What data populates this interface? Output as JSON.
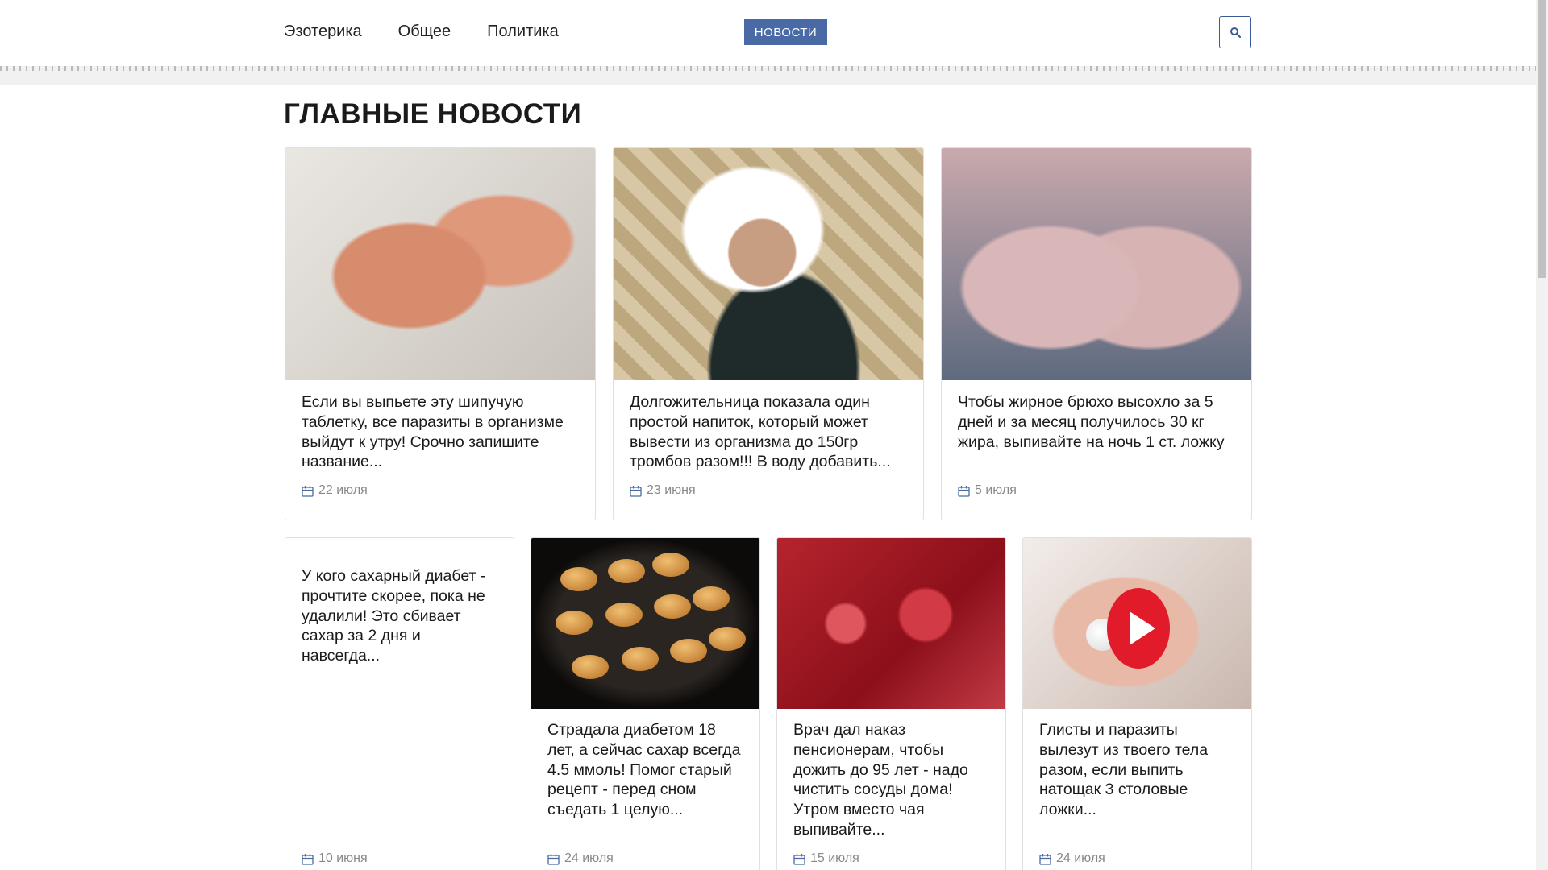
{
  "nav": {
    "items": [
      "Эзотерика",
      "Общее",
      "Политика"
    ],
    "news_button": "НОВОСТИ",
    "search_icon": "search-icon"
  },
  "section_title": "ГЛАВНЫЕ НОВОСТИ",
  "cards": [
    {
      "title": "Если вы выпьете эту шипучую таблетку, все паразиты в организме выйдут к утру! Срочно запишите название...",
      "date": "22 июля",
      "image": "fingers-with-larvae"
    },
    {
      "title": "Долгожительница показала один простой напиток, который может вывести из организма до 150гр тромбов разом!!! В воду добавить...",
      "date": "23 июня",
      "image": "elderly-woman-drinking"
    },
    {
      "title": "Чтобы жирное брюхо высохло за 5 дней и за месяц получилось 30 кг жира, выпивайте на ночь 1 ст. ложку",
      "date": "5 июля",
      "image": "thighs"
    },
    {
      "title": "У кого сахарный диабет - прочтите скорее, пока не удалили! Это сбивает сахар за 2 дня и навсегда...",
      "date": "10 июня",
      "image": ""
    },
    {
      "title": "Страдала диабетом 18 лет, а сейчас сахар всегда 4.5 ммоль! Помог старый рецепт - перед сном съедать 1 целую...",
      "date": "24 июля",
      "image": "baked-buns-tray"
    },
    {
      "title": "Врач дал наказ пенсионерам, чтобы дожить до 95 лет - надо чистить сосуды дома! Утром вместо чая выпивайте...",
      "date": "15 июля",
      "image": "blood-cells"
    },
    {
      "title": "Глисты и паразиты вылезут из твоего тела разом, если выпить натощак 3 столовые ложки...",
      "date": "24 июля",
      "image": "pill-in-hand-video"
    }
  ],
  "colors": {
    "accent": "#4a6aa5",
    "search_border": "#3b5b98",
    "play": "#e11b2a"
  }
}
